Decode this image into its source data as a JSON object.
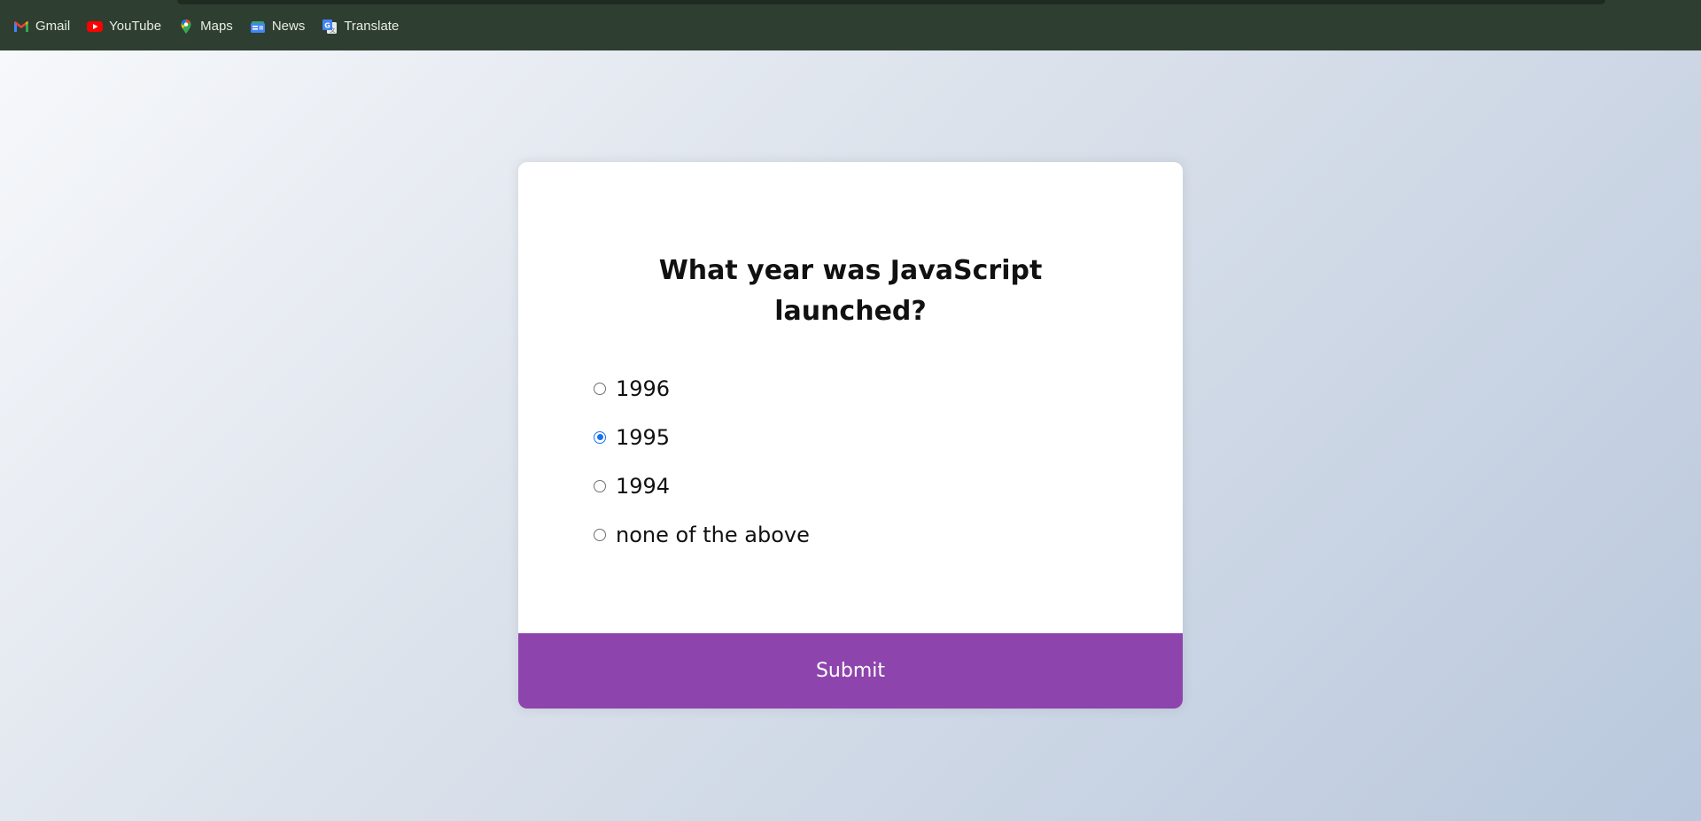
{
  "bookmarks": [
    {
      "label": "Gmail",
      "icon": "gmail-icon"
    },
    {
      "label": "YouTube",
      "icon": "youtube-icon"
    },
    {
      "label": "Maps",
      "icon": "maps-icon"
    },
    {
      "label": "News",
      "icon": "news-icon"
    },
    {
      "label": "Translate",
      "icon": "translate-icon"
    }
  ],
  "quiz": {
    "question": "What year was JavaScript launched?",
    "answers": [
      {
        "label": "1996",
        "checked": false
      },
      {
        "label": "1995",
        "checked": true
      },
      {
        "label": "1994",
        "checked": false
      },
      {
        "label": "none of the above",
        "checked": false
      }
    ],
    "submit_label": "Submit"
  },
  "colors": {
    "toolbar_bg": "#2e3e31",
    "accent": "#8e44ad",
    "radio_checked": "#1a73e8"
  }
}
